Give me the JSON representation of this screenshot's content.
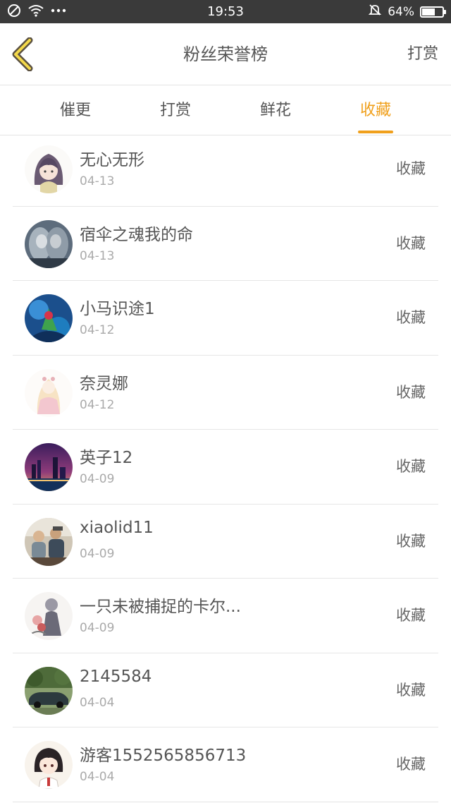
{
  "status_bar": {
    "time": "19:53",
    "battery_text": "64%",
    "battery_level": 0.64,
    "icons": [
      "no-disturb-icon",
      "wifi-icon",
      "more-dots-icon",
      "mute-bell-icon",
      "battery-icon"
    ]
  },
  "nav": {
    "back_icon": "chevron-left-icon",
    "title": "粉丝荣誉榜",
    "right_label": "打赏"
  },
  "tabs": [
    {
      "label": "催更",
      "active": false
    },
    {
      "label": "打赏",
      "active": false
    },
    {
      "label": "鲜花",
      "active": false
    },
    {
      "label": "收藏",
      "active": true
    }
  ],
  "colors": {
    "accent": "#f0a01c",
    "status_bar": "#3a3a3a",
    "text": "#555555",
    "subtext": "#aaaaaa"
  },
  "rows": [
    {
      "name": "无心无形",
      "date": "04-13",
      "type": "收藏"
    },
    {
      "name": "宿伞之魂我的命",
      "date": "04-13",
      "type": "收藏"
    },
    {
      "name": "小马识途1",
      "date": "04-12",
      "type": "收藏"
    },
    {
      "name": "奈灵娜",
      "date": "04-12",
      "type": "收藏"
    },
    {
      "name": "英子12",
      "date": "04-09",
      "type": "收藏"
    },
    {
      "name": "xiaolid11",
      "date": "04-09",
      "type": "收藏"
    },
    {
      "name": "一只未被捕捉的卡尔...",
      "date": "04-09",
      "type": "收藏"
    },
    {
      "name": "2145584",
      "date": "04-04",
      "type": "收藏"
    },
    {
      "name": "游客1552565856713",
      "date": "04-04",
      "type": "收藏"
    }
  ]
}
